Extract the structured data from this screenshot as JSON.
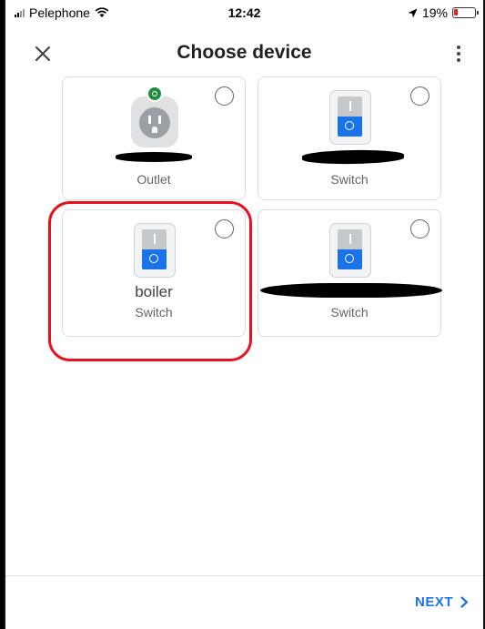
{
  "status_bar": {
    "carrier": "Pelephone",
    "time": "12:42",
    "battery_percent": "19%",
    "battery_level": 0.19,
    "battery_color": "#e62020"
  },
  "app_bar": {
    "title": "Choose device",
    "close_icon": "close-icon",
    "more_icon": "more-vert-icon"
  },
  "devices": [
    {
      "name": "",
      "type": "Outlet",
      "icon": "outlet-icon",
      "name_redacted": true,
      "selected": false
    },
    {
      "name": "",
      "type": "Switch",
      "icon": "switch-icon",
      "name_redacted": true,
      "selected": false
    },
    {
      "name": "boiler",
      "type": "Switch",
      "icon": "switch-icon",
      "name_redacted": false,
      "selected": false,
      "highlighted": true
    },
    {
      "name": "",
      "type": "Switch",
      "icon": "switch-icon",
      "name_redacted": true,
      "selected": false
    }
  ],
  "footer": {
    "next_label": "NEXT",
    "next_icon": "chevron-right-icon"
  },
  "colors": {
    "accent": "#1a73e8",
    "highlight": "#e8101e",
    "outlet_on": "#1e8e3e"
  }
}
